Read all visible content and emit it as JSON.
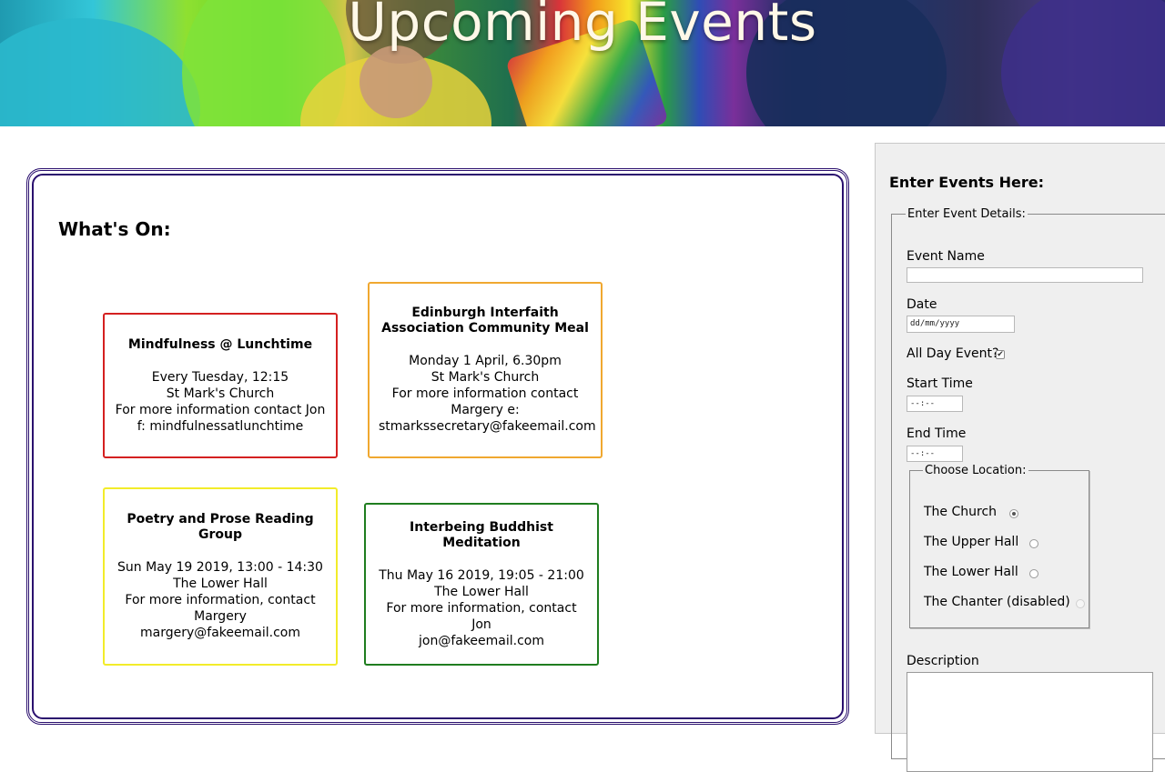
{
  "banner": {
    "title": "Upcoming Events"
  },
  "whats_on": {
    "heading": "What's On:",
    "events": [
      {
        "title": "Mindfulness @ Lunchtime",
        "lines": [
          "Every Tuesday, 12:15",
          "St Mark's Church",
          "For more information contact Jon",
          "f: mindfulnessatlunchtime"
        ],
        "border_color": "#d42020"
      },
      {
        "title": "Edinburgh Interfaith Association Community Meal",
        "lines": [
          "Monday 1 April, 6.30pm",
          "St Mark's Church",
          "For more information contact",
          "Margery e:",
          "stmarkssecretary@fakeemail.com"
        ],
        "border_color": "#f0a830"
      },
      {
        "title": "Poetry and Prose Reading Group",
        "lines": [
          "Sun May 19 2019, 13:00 - 14:30",
          "The Lower Hall",
          "For more information, contact",
          "Margery",
          "margery@fakeemail.com"
        ],
        "border_color": "#f2ec2a"
      },
      {
        "title": "Interbeing Buddhist Meditation",
        "lines": [
          "Thu May 16 2019, 19:05 - 21:00",
          "The Lower Hall",
          "For more information, contact Jon",
          "jon@fakeemail.com"
        ],
        "border_color": "#1f7d1f"
      }
    ]
  },
  "form": {
    "heading": "Enter Events Here:",
    "details_legend": "Enter Event Details:",
    "event_name_label": "Event Name",
    "event_name_value": "",
    "date_label": "Date",
    "date_placeholder": "dd/mm/yyyy",
    "all_day_label": "All Day Event?",
    "all_day_checked": true,
    "all_day_mark": "✔",
    "start_time_label": "Start Time",
    "start_time_placeholder": "--:--",
    "end_time_label": "End Time",
    "end_time_placeholder": "--:--",
    "location_legend": "Choose Location:",
    "locations": [
      {
        "label": "The Church",
        "checked": true,
        "disabled": false
      },
      {
        "label": "The Upper Hall",
        "checked": false,
        "disabled": false
      },
      {
        "label": "The Lower Hall",
        "checked": false,
        "disabled": false
      },
      {
        "label": "The Chanter (disabled)",
        "checked": false,
        "disabled": true
      }
    ],
    "description_label": "Description",
    "description_value": ""
  }
}
